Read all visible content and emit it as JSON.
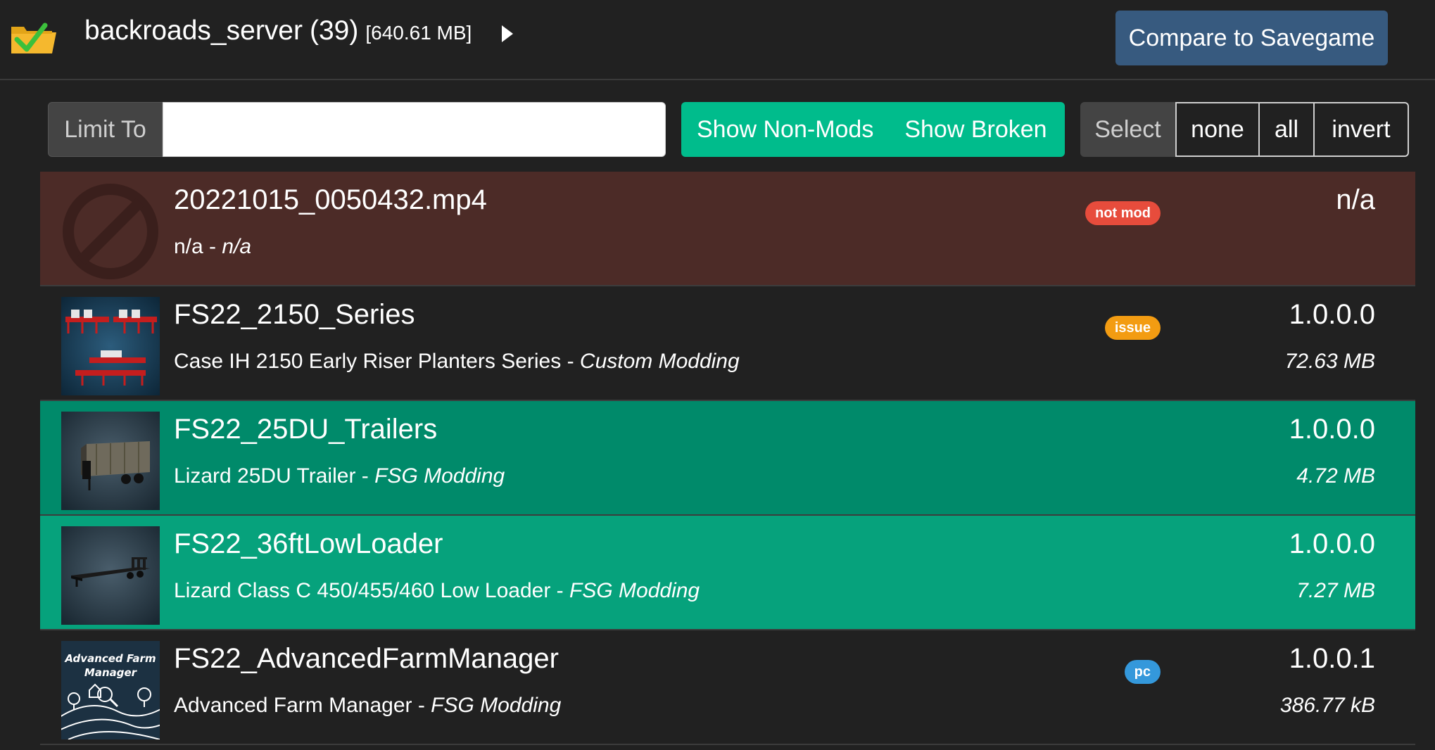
{
  "header": {
    "collection_name": "backroads_server",
    "mod_count": "(39)",
    "collection_size": "[640.61 MB]",
    "compare_label": "Compare to Savegame",
    "folder_icon": "folder-check-icon",
    "expand_icon": "caret-right-icon"
  },
  "filter": {
    "limit_label": "Limit To",
    "limit_value": "",
    "show_non_mods_label": "Show Non-Mods",
    "show_broken_label": "Show Broken",
    "select_label": "Select",
    "select_none": "none",
    "select_all": "all",
    "select_invert": "invert"
  },
  "colors": {
    "accent_blue": "#375a7f",
    "accent_green": "#00bc8c",
    "notmod_row": "#4c2b27",
    "selected_row_a": "#008a6a",
    "selected_row_b": "#06a27c",
    "badge_notmod": "#e74c3c",
    "badge_issue": "#f39c12",
    "badge_pc": "#3498db"
  },
  "mods": [
    {
      "name": "20221015_0050432.mp4",
      "title": "n/a",
      "separator": " - ",
      "author": "n/a",
      "version": "n/a",
      "size": "",
      "badge": "not mod",
      "thumb_icon": "no-entry-icon"
    },
    {
      "name": "FS22_2150_Series",
      "title": "Case IH 2150 Early Riser Planters Series",
      "separator": " - ",
      "author": "Custom Modding",
      "version": "1.0.0.0",
      "size": "72.63 MB",
      "badge": "issue",
      "thumb_icon": "planter-thumbnail"
    },
    {
      "name": "FS22_25DU_Trailers",
      "title": "Lizard 25DU Trailer",
      "separator": " - ",
      "author": "FSG Modding",
      "version": "1.0.0.0",
      "size": "4.72 MB",
      "badge": "",
      "thumb_icon": "trailer-thumbnail"
    },
    {
      "name": "FS22_36ftLowLoader",
      "title": "Lizard Class C 450/455/460 Low Loader",
      "separator": " - ",
      "author": "FSG Modding",
      "version": "1.0.0.0",
      "size": "7.27 MB",
      "badge": "",
      "thumb_icon": "lowloader-thumbnail"
    },
    {
      "name": "FS22_AdvancedFarmManager",
      "title": "Advanced Farm Manager",
      "separator": " - ",
      "author": "FSG Modding",
      "version": "1.0.0.1",
      "size": "386.77 kB",
      "badge": "pc",
      "thumb_icon": "farm-manager-thumbnail",
      "thumb_text_1": "Advanced Farm",
      "thumb_text_2": "Manager"
    }
  ]
}
